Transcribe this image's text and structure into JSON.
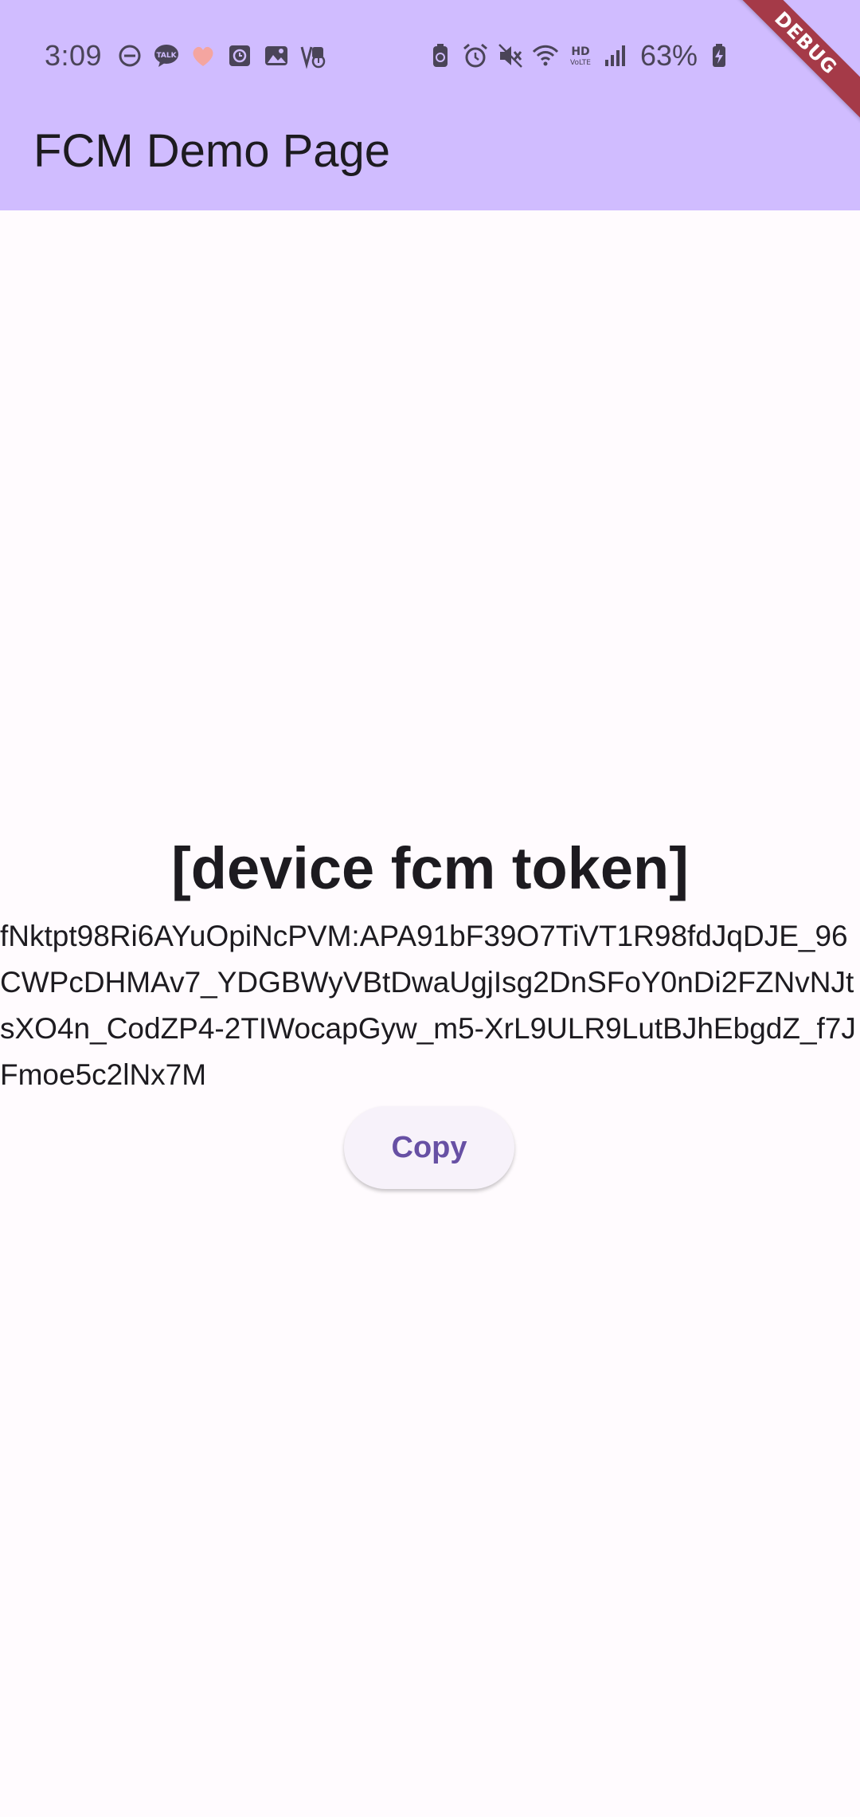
{
  "status_bar": {
    "time": "3:09",
    "battery_percent": "63%",
    "left_icons": [
      "do-not-disturb-icon",
      "kakaotalk-icon",
      "heart-icon",
      "clock-app-icon",
      "gallery-icon",
      "screenshot-icon"
    ],
    "right_icons": [
      "battery-saver-icon",
      "alarm-icon",
      "mute-icon",
      "wifi-icon",
      "hd-voice-icon",
      "signal-icon",
      "battery-charging-icon"
    ]
  },
  "app_bar": {
    "title": "FCM Demo Page",
    "background": "#d0bcff"
  },
  "debug_banner": {
    "label": "DEBUG",
    "color": "#a53a48"
  },
  "main": {
    "heading": "[device fcm token]",
    "token": "fNktpt98Ri6AYuOpiNcPVM:APA91bF39O7TiVT1R98fdJqDJE_96CWPcDHMAv7_YDGBWyVBtDwaUgjIsg2DnSFoY0nDi2FZNvNJtsXO4n_CodZP4-2TIWocapGyw_m5-XrL9ULR9LutBJhEbgdZ_f7JFmoe5c2lNx7M",
    "copy_label": "Copy"
  },
  "colors": {
    "accent": "#6750a4",
    "surface": "#fffbfe"
  }
}
